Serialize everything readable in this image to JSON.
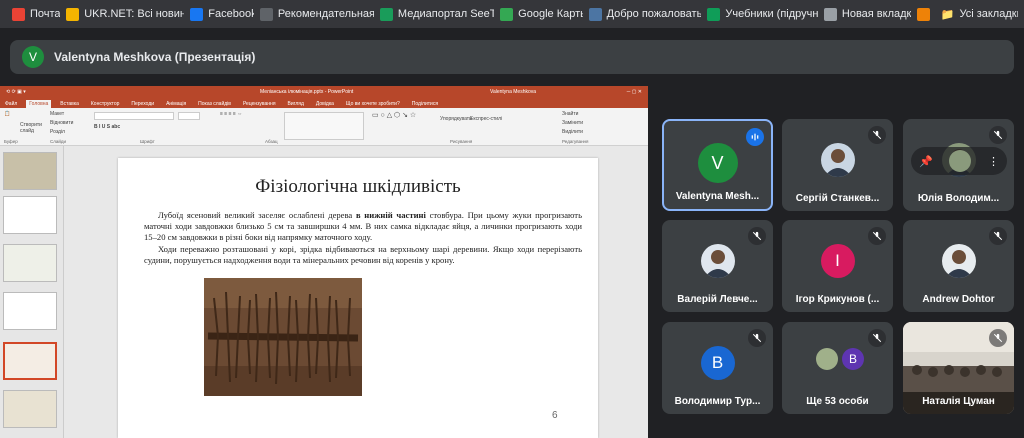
{
  "bookmarks": [
    {
      "label": "Почта",
      "icon": "mail-icon",
      "color": "#ea4335"
    },
    {
      "label": "UKR.NET: Всі новин...",
      "icon": "ukrnet-icon",
      "color": "#f4b400"
    },
    {
      "label": "Facebook",
      "icon": "facebook-icon",
      "color": "#1877f2"
    },
    {
      "label": "Рекомендательная...",
      "icon": "link-icon",
      "color": "#5f6368"
    },
    {
      "label": "Медиапортал SeeT...",
      "icon": "seet-icon",
      "color": "#1a9c5a"
    },
    {
      "label": "Google Карты",
      "icon": "maps-icon",
      "color": "#34a853"
    },
    {
      "label": "Добро пожаловать...",
      "icon": "vk-icon",
      "color": "#4c75a3"
    },
    {
      "label": "Учебники (підручн...",
      "icon": "book-icon",
      "color": "#0f9d58"
    },
    {
      "label": "Новая вкладка",
      "icon": "globe-icon",
      "color": "#9aa0a6"
    },
    {
      "label": "",
      "icon": "ok-icon",
      "color": "#ee8208"
    }
  ],
  "all_bookmarks": "Усі закладки",
  "presenter": {
    "initial": "V",
    "label": "Valentyna Meshkova (Презентація)"
  },
  "ppt": {
    "file": "Меліанська ілюмінація.pptx - PowerPoint",
    "user": "Valentyna Meshkova",
    "tabs": [
      "Файл",
      "Головна",
      "Вставка",
      "Конструктор",
      "Переходи",
      "Анімація",
      "Показ слайдів",
      "Рецензування",
      "Вигляд",
      "Довідка",
      "Що ви хочете зробити?",
      "Поділитися"
    ],
    "ribbon": {
      "new_slide": "Створити слайд",
      "layout": "Макет",
      "reset": "Відновити",
      "section": "Розділ",
      "clipboard": "Буфер",
      "slides": "Слайди",
      "font": "Шрифт",
      "paragraph": "Абзац",
      "drawing": "Рисування",
      "editing": "Редагування",
      "find": "Знайти",
      "replace": "Замінити",
      "select": "Виділити",
      "arrange": "Упорядкувати",
      "styles": "Експрес-стилі"
    },
    "slide": {
      "title": "Фізіологічна шкідливість",
      "p1_a": "Лубоїд ясеновий великий заселяє ослаблені дерева ",
      "p1_bold": "в нижній частині",
      "p1_b": " стовбура. При цьому жуки прогризають маточні ходи завдовжки близько 5 см та завширшки 4 мм. В них самка відкладає яйця, а личинки прогризають ходи 15–20 см завдовжки в різні боки від напрямку маточного ходу.",
      "p2": "Ходи переважно розташовані у корі, зрідка відбиваються на верхньому шарі деревини. Якщо ходи перерізають судини, порушується надходження води та мінеральних речовин від коренів у крону.",
      "number": "6"
    }
  },
  "participants": [
    {
      "name": "Valentyna Meshkova",
      "display": "Valentyna Mesh...",
      "initial": "V",
      "color": "#1e8e3e",
      "kind": "letter",
      "speaking": true
    },
    {
      "name": "Сергій Станкевич",
      "display": "Сергій Станкев...",
      "initial": "",
      "color": "#c9d6e3",
      "kind": "photo",
      "speaking": false
    },
    {
      "name": "Юлія Володимирівна",
      "display": "Юлія Володим...",
      "initial": "",
      "color": "#8a9a7c",
      "kind": "photo",
      "speaking": false
    },
    {
      "name": "Валерій Левченко",
      "display": "Валерій Левче...",
      "initial": "",
      "color": "#dfe6ee",
      "kind": "photo",
      "speaking": false
    },
    {
      "name": "Ігор Крикунов",
      "display": "Ігор Крикунов (...",
      "initial": "I",
      "color": "#d81b60",
      "kind": "letter",
      "speaking": false
    },
    {
      "name": "Andrew Dohtor",
      "display": "Andrew Dohtor",
      "initial": "",
      "color": "#e7ecef",
      "kind": "photo",
      "speaking": false
    },
    {
      "name": "Володимир Турченко",
      "display": "Володимир Тур...",
      "initial": "В",
      "color": "#1967d2",
      "kind": "letter",
      "speaking": false
    },
    {
      "name": "Ще 53 особи",
      "display": "Ще 53 особи",
      "initial": "В",
      "color": "#5e35b1",
      "kind": "more",
      "speaking": false
    },
    {
      "name": "Наталія Цуман",
      "display": "Наталія Цуман",
      "initial": "",
      "color": "#7a6a52",
      "kind": "video",
      "speaking": false
    }
  ]
}
